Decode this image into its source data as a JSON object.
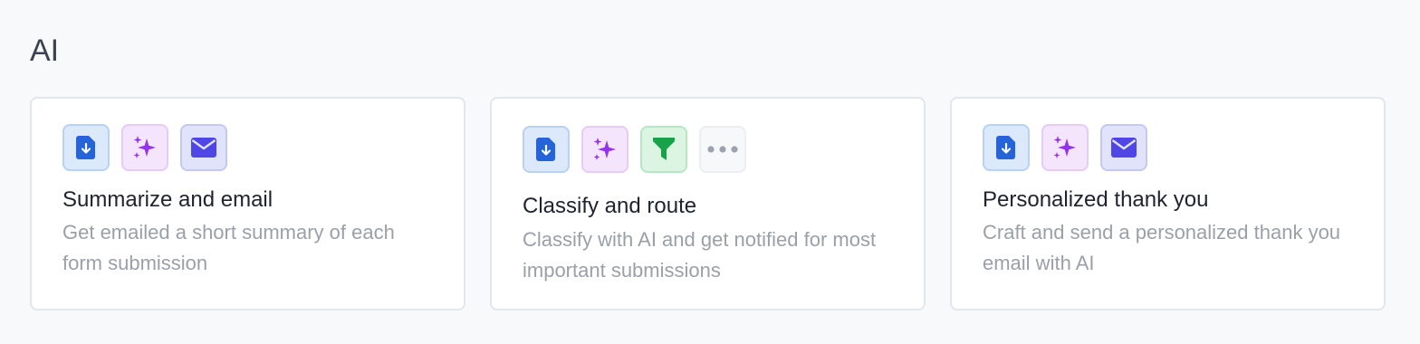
{
  "section": {
    "title": "AI"
  },
  "cards": [
    {
      "title": "Summarize and email",
      "description": "Get emailed a short summary of each form submission",
      "icons": [
        "download-document-icon",
        "ai-sparkles-icon",
        "mail-icon"
      ]
    },
    {
      "title": "Classify and route",
      "description": "Classify with AI and get notified for most important submissions",
      "icons": [
        "download-document-icon",
        "ai-sparkles-icon",
        "filter-icon",
        "more-icon"
      ]
    },
    {
      "title": "Personalized thank you",
      "description": "Craft and send a personalized thank you email with AI",
      "icons": [
        "download-document-icon",
        "ai-sparkles-icon",
        "mail-icon"
      ]
    }
  ],
  "colors": {
    "doc_icon": "#2563d9",
    "ai_icon": "#9333ea",
    "mail_icon": "#4f46e5",
    "filter_icon": "#16a34a",
    "more_icon": "#9ca3af"
  }
}
